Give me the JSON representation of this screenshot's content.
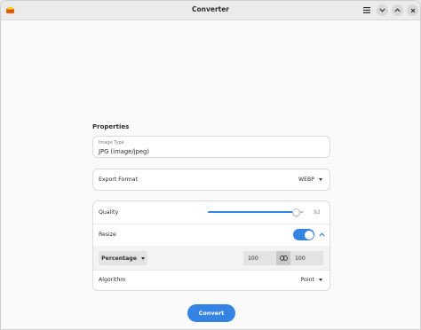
{
  "window": {
    "title": "Converter"
  },
  "headerbar": {
    "menu_icon": "hamburger-menu-icon",
    "minimize_icon": "chevron-down-icon",
    "maximize_icon": "chevron-up-icon",
    "close_icon": "close-icon",
    "app_icon": "converter-app-icon"
  },
  "properties": {
    "section_title": "Properties",
    "image_type": {
      "label": "Image Type",
      "value": "JPG (image/jpeg)"
    },
    "export_format": {
      "label": "Export Format",
      "value": "WEBP"
    },
    "quality": {
      "label": "Quality",
      "value": "92",
      "fraction": 0.92
    },
    "resize": {
      "label": "Resize",
      "enabled": true,
      "expand_icon": "chevron-up-icon"
    },
    "resize_options": {
      "mode": "Percentage",
      "width": "100",
      "link_icon": "link-icon",
      "height": "100"
    },
    "algorithm": {
      "label": "Algorithm",
      "value": "Point"
    }
  },
  "actions": {
    "convert_label": "Convert"
  },
  "colors": {
    "accent": "#3584e4",
    "background": "#fafafa",
    "card": "#ffffff"
  }
}
